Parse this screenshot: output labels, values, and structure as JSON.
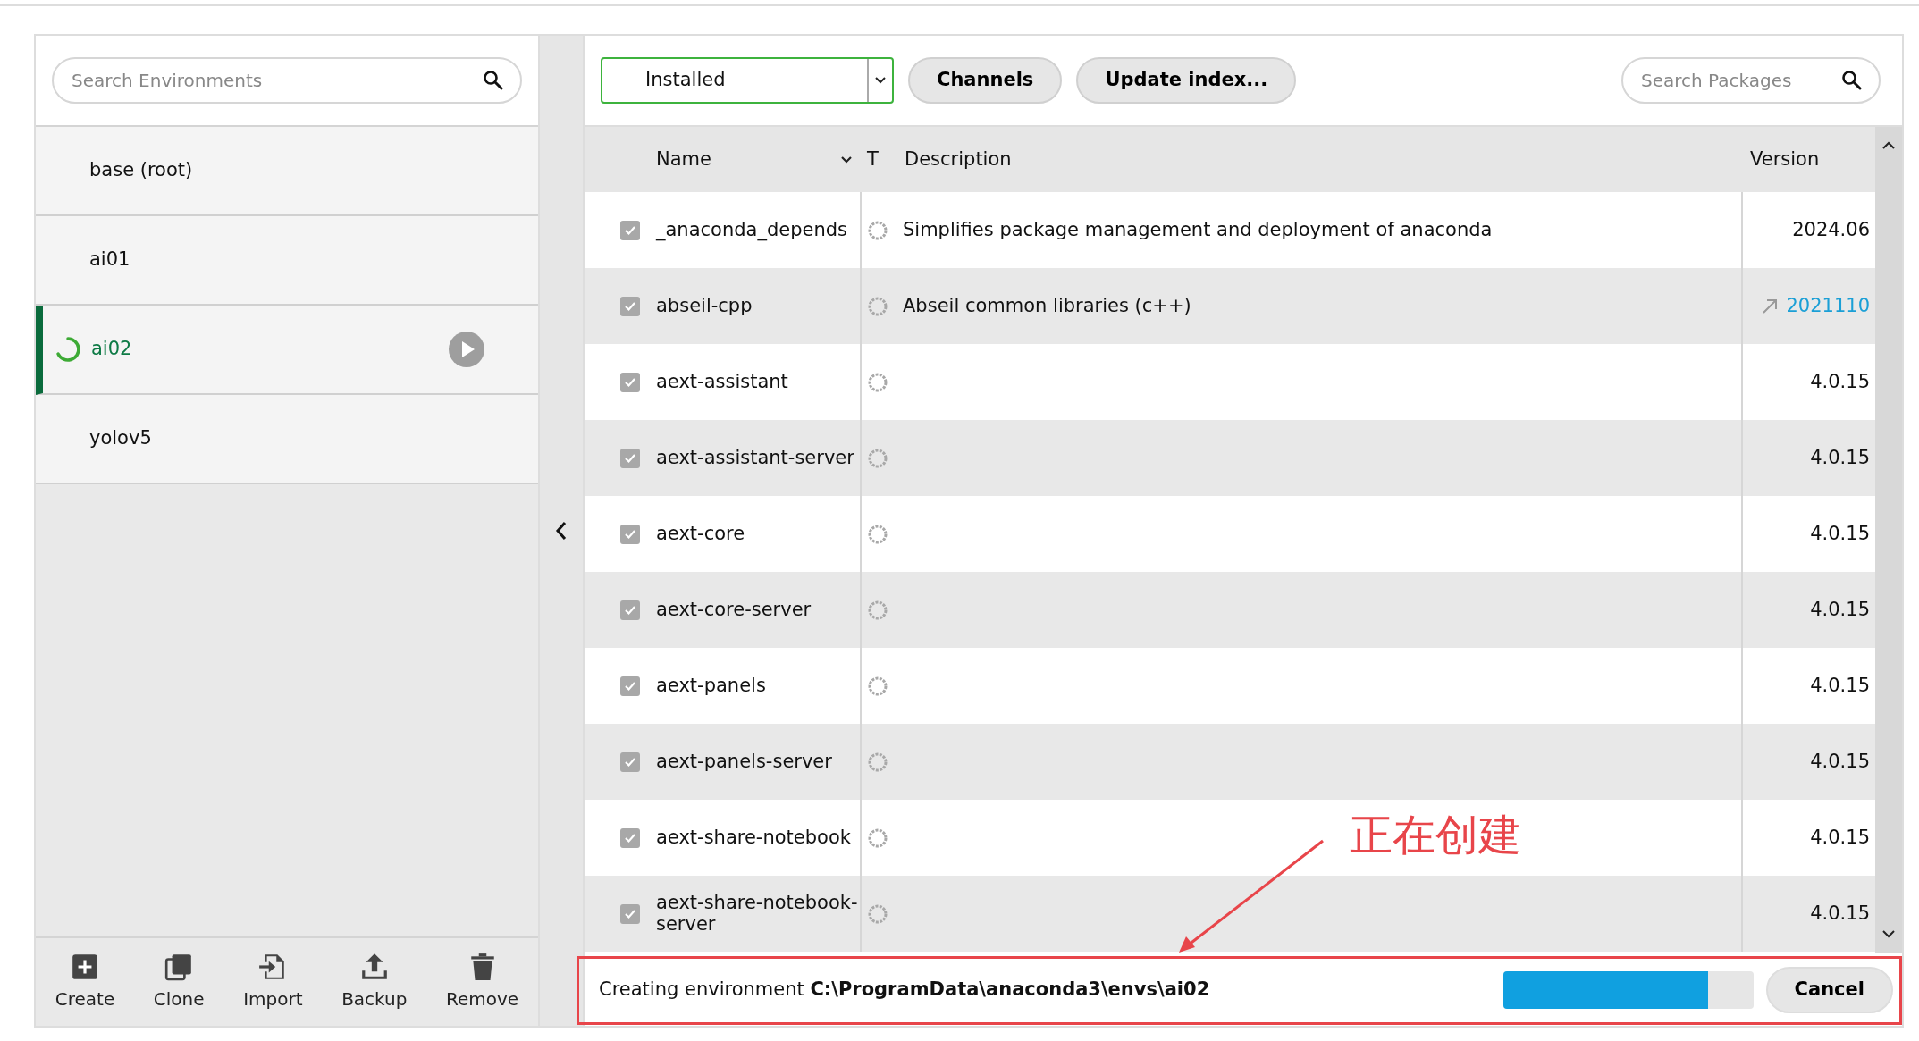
{
  "environments": {
    "search": {
      "placeholder": "Search Environments"
    },
    "items": [
      {
        "name": "base (root)",
        "selected": false,
        "busy": false
      },
      {
        "name": "ai01",
        "selected": false,
        "busy": false
      },
      {
        "name": "ai02",
        "selected": true,
        "busy": true
      },
      {
        "name": "yolov5",
        "selected": false,
        "busy": false
      }
    ],
    "actions": [
      {
        "label": "Create",
        "kind": "create"
      },
      {
        "label": "Clone",
        "kind": "clone"
      },
      {
        "label": "Import",
        "kind": "import"
      },
      {
        "label": "Backup",
        "kind": "backup"
      },
      {
        "label": "Remove",
        "kind": "remove"
      }
    ]
  },
  "packages": {
    "filter": "Installed",
    "buttons": [
      "Channels",
      "Update index..."
    ],
    "search": {
      "placeholder": "Search Packages"
    },
    "columns": [
      "Name",
      "T",
      "Description",
      "Version"
    ],
    "rows": [
      {
        "name": "_anaconda_depends",
        "checked": true,
        "description": "Simplifies package management and deployment of anaconda",
        "version": "2024.06",
        "upgradable": false
      },
      {
        "name": "abseil-cpp",
        "checked": true,
        "description": "Abseil common libraries (c++)",
        "version": "2021110",
        "upgradable": true
      },
      {
        "name": "aext-assistant",
        "checked": true,
        "description": "",
        "version": "4.0.15",
        "upgradable": false
      },
      {
        "name": "aext-assistant-server",
        "checked": true,
        "description": "",
        "version": "4.0.15",
        "upgradable": false
      },
      {
        "name": "aext-core",
        "checked": true,
        "description": "",
        "version": "4.0.15",
        "upgradable": false
      },
      {
        "name": "aext-core-server",
        "checked": true,
        "description": "",
        "version": "4.0.15",
        "upgradable": false
      },
      {
        "name": "aext-panels",
        "checked": true,
        "description": "",
        "version": "4.0.15",
        "upgradable": false
      },
      {
        "name": "aext-panels-server",
        "checked": true,
        "description": "",
        "version": "4.0.15",
        "upgradable": false
      },
      {
        "name": "aext-share-notebook",
        "checked": true,
        "description": "",
        "version": "4.0.15",
        "upgradable": false
      },
      {
        "name": "aext-share-notebook-server",
        "checked": true,
        "description": "",
        "version": "4.0.15",
        "upgradable": false
      }
    ]
  },
  "status": {
    "message": "Creating environment **C:\\ProgramData\\anaconda3\\envs\\ai02**",
    "cancel": "Cancel",
    "progress": {
      "level": 0.82
    }
  },
  "annotation": {
    "text": "正在创建"
  }
}
